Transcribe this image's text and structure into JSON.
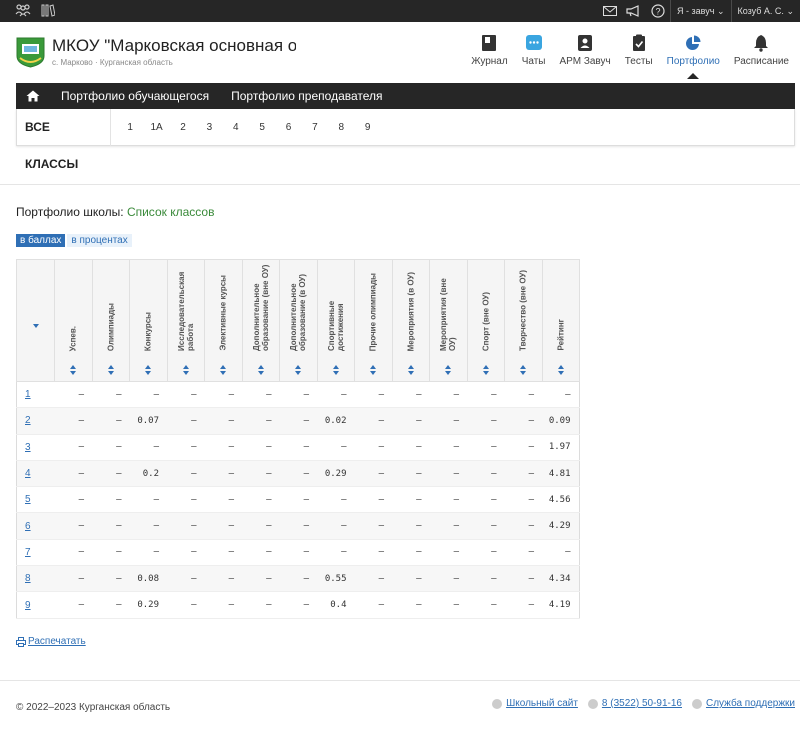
{
  "topbar": {
    "role_label": "Я - завуч",
    "user_label": "Козуб А. С."
  },
  "header": {
    "school_name": "МКОУ \"Марковская основная общ",
    "school_location": "с. Марково · Курганская область"
  },
  "nav": [
    {
      "label": "Журнал",
      "icon": "journal-icon"
    },
    {
      "label": "Чаты",
      "icon": "chat-icon"
    },
    {
      "label": "АРМ Завуч",
      "icon": "id-badge-icon"
    },
    {
      "label": "Тесты",
      "icon": "tests-icon"
    },
    {
      "label": "Портфолио",
      "icon": "pie-chart-icon",
      "active": true
    },
    {
      "label": "Расписание",
      "icon": "bell-icon"
    }
  ],
  "subnav": {
    "tab1": "Портфолио обучающегося",
    "tab2": "Портфолио преподавателя"
  },
  "classes": {
    "all_label": "ВСЕ КЛАССЫ",
    "items": [
      "1",
      "1А",
      "2",
      "3",
      "4",
      "5",
      "6",
      "7",
      "8",
      "9"
    ]
  },
  "portfolio": {
    "title_prefix": "Портфолио школы:",
    "title_link": "Список классов",
    "toggle_points": "в баллах",
    "toggle_percent": "в процентах"
  },
  "table": {
    "columns": [
      "Успев.",
      "Олимпиады",
      "Конкурсы",
      "Исследовательская работа",
      "Элективные курсы",
      "Дополнительное образование (вне ОУ)",
      "Дополнительное образование (в ОУ)",
      "Спортивные достижения",
      "Прочие олимпиады",
      "Мероприятия (в ОУ)",
      "Мероприятия (вне ОУ)",
      "Спорт (вне ОУ)",
      "Творчество (вне ОУ)",
      "Рейтинг"
    ],
    "rows": [
      {
        "name": "1",
        "cells": [
          "—",
          "—",
          "—",
          "—",
          "—",
          "—",
          "—",
          "—",
          "—",
          "—",
          "—",
          "—",
          "—",
          "—"
        ]
      },
      {
        "name": "2",
        "cells": [
          "—",
          "—",
          "0.07",
          "—",
          "—",
          "—",
          "—",
          "0.02",
          "—",
          "—",
          "—",
          "—",
          "—",
          "0.09"
        ]
      },
      {
        "name": "3",
        "cells": [
          "—",
          "—",
          "—",
          "—",
          "—",
          "—",
          "—",
          "—",
          "—",
          "—",
          "—",
          "—",
          "—",
          "1.97"
        ]
      },
      {
        "name": "4",
        "cells": [
          "—",
          "—",
          "0.2",
          "—",
          "—",
          "—",
          "—",
          "0.29",
          "—",
          "—",
          "—",
          "—",
          "—",
          "4.81"
        ]
      },
      {
        "name": "5",
        "cells": [
          "—",
          "—",
          "—",
          "—",
          "—",
          "—",
          "—",
          "—",
          "—",
          "—",
          "—",
          "—",
          "—",
          "4.56"
        ]
      },
      {
        "name": "6",
        "cells": [
          "—",
          "—",
          "—",
          "—",
          "—",
          "—",
          "—",
          "—",
          "—",
          "—",
          "—",
          "—",
          "—",
          "4.29"
        ]
      },
      {
        "name": "7",
        "cells": [
          "—",
          "—",
          "—",
          "—",
          "—",
          "—",
          "—",
          "—",
          "—",
          "—",
          "—",
          "—",
          "—",
          "—"
        ]
      },
      {
        "name": "8",
        "cells": [
          "—",
          "—",
          "0.08",
          "—",
          "—",
          "—",
          "—",
          "0.55",
          "—",
          "—",
          "—",
          "—",
          "—",
          "4.34"
        ]
      },
      {
        "name": "9",
        "cells": [
          "—",
          "—",
          "0.29",
          "—",
          "—",
          "—",
          "—",
          "0.4",
          "—",
          "—",
          "—",
          "—",
          "—",
          "4.19"
        ]
      }
    ]
  },
  "print_label": "Распечатать",
  "footer": {
    "copyright": "© 2022–2023 Курганская область",
    "site_link": "Школьный сайт",
    "phone_link": "8 (3522) 50-91-16",
    "support_link": "Служба поддержки"
  },
  "colors": {
    "accent": "#2f6fb5",
    "dark": "#262626",
    "green": "#3a8a3a"
  }
}
